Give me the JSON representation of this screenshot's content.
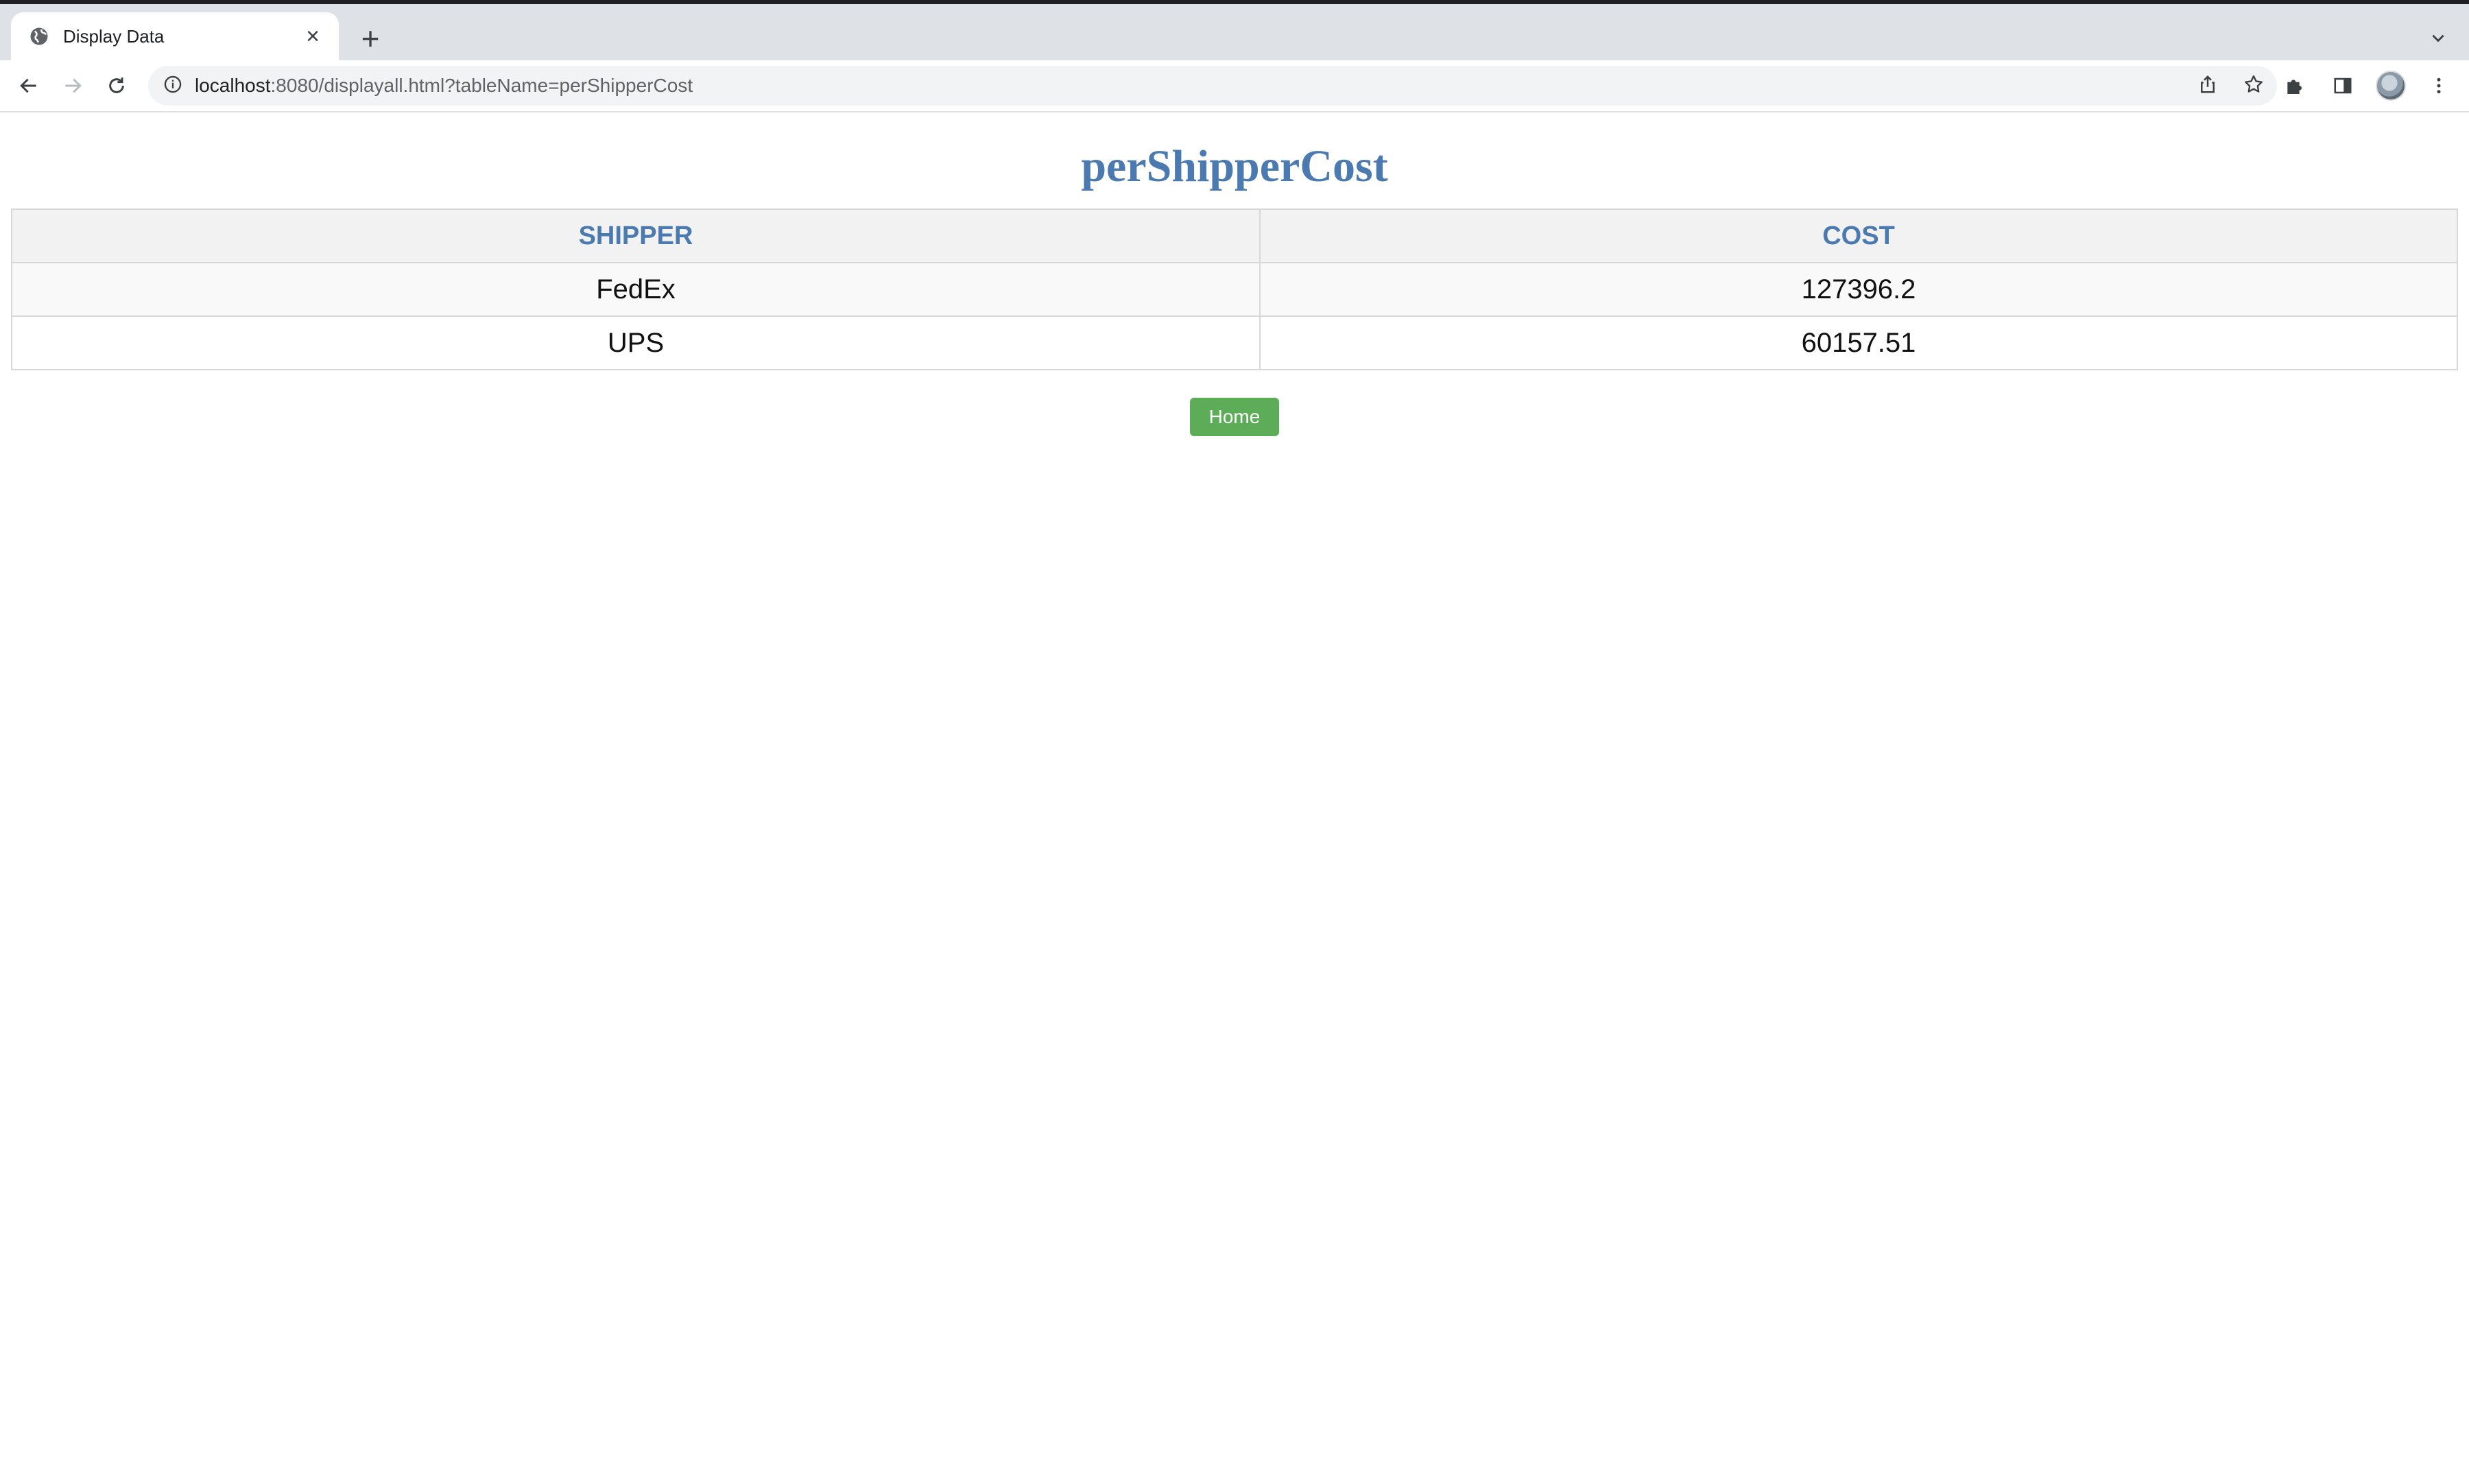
{
  "browser": {
    "tab_title": "Display Data",
    "tab_close": "×",
    "new_tab": "+",
    "url_host": "localhost",
    "url_rest": ":8080/displayall.html?tableName=perShipperCost"
  },
  "page": {
    "title": "perShipperCost",
    "home_button": "Home"
  },
  "table": {
    "headers": [
      "SHIPPER",
      "COST"
    ],
    "rows": [
      [
        "FedEx",
        "127396.2"
      ],
      [
        "UPS",
        "60157.51"
      ]
    ]
  },
  "colors": {
    "accent": "#4a7ab0",
    "button": "#5cac58",
    "header_bg": "#f2f2f2"
  }
}
